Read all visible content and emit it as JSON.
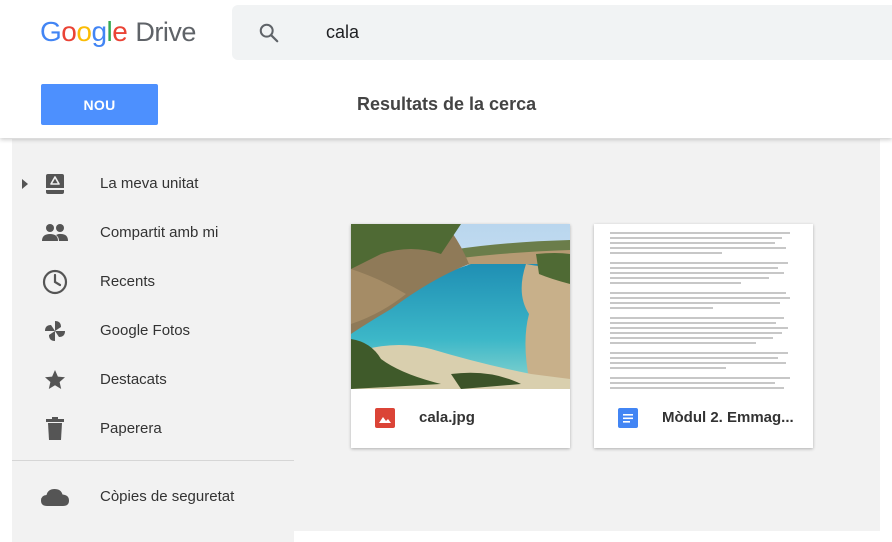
{
  "header": {
    "logo": {
      "word1": [
        "G",
        "o",
        "o",
        "g",
        "l",
        "e"
      ],
      "word2": "Drive"
    },
    "search": {
      "icon": "search-icon",
      "value": "cala"
    },
    "new_button": "NOU",
    "results_title": "Resultats de la cerca"
  },
  "sidebar": {
    "items": [
      {
        "label": "La meva unitat",
        "icon": "my-drive-icon"
      },
      {
        "label": "Compartit amb mi",
        "icon": "people-icon"
      },
      {
        "label": "Recents",
        "icon": "clock-icon"
      },
      {
        "label": "Google Fotos",
        "icon": "pinwheel-icon"
      },
      {
        "label": "Destacats",
        "icon": "star-icon"
      },
      {
        "label": "Paperera",
        "icon": "trash-icon"
      }
    ],
    "backup": {
      "label": "Còpies de seguretat",
      "icon": "cloud-icon"
    }
  },
  "results": [
    {
      "name": "cala.jpg",
      "type": "image",
      "icon": "image-file-icon",
      "color": "#db4437"
    },
    {
      "name": "Mòdul 2. Emmag...",
      "type": "document",
      "icon": "docs-file-icon",
      "color": "#4285f4"
    }
  ],
  "colors": {
    "accent": "#4d90fe",
    "sidebar_bg": "#f2f2f2"
  }
}
